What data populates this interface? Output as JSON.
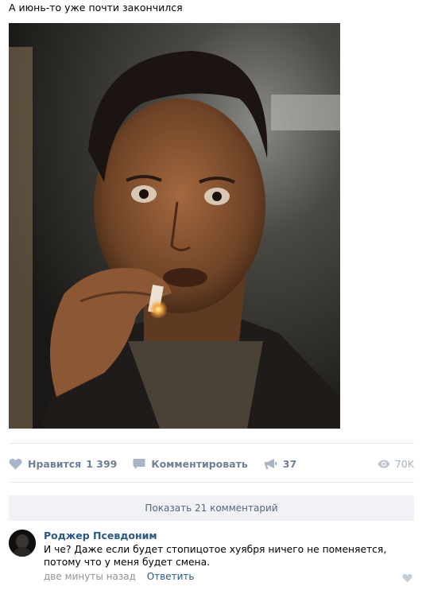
{
  "post": {
    "text": "А июнь-то уже почти закончился"
  },
  "actions": {
    "like_label": "Нравится",
    "like_count": "1 399",
    "comment_label": "Комментировать",
    "share_count": "37",
    "views_count": "70K"
  },
  "comments": {
    "show_more_label": "Показать 21 комментарий",
    "items": [
      {
        "author": "Роджер Псевдоним",
        "text": "И че? Даже если будет стопицотое хуября ничего не поменяется, потому что у меня будет смена.",
        "time": "две минуты назад",
        "reply_label": "Ответить"
      }
    ]
  },
  "icons": {
    "like": "heart-icon",
    "comment": "speech-bubble-icon",
    "share": "megaphone-icon",
    "views": "eye-icon"
  },
  "colors": {
    "action_text": "#6e7f96",
    "link": "#2a5885",
    "muted": "#939393",
    "button_bg": "#f0f2f5"
  }
}
